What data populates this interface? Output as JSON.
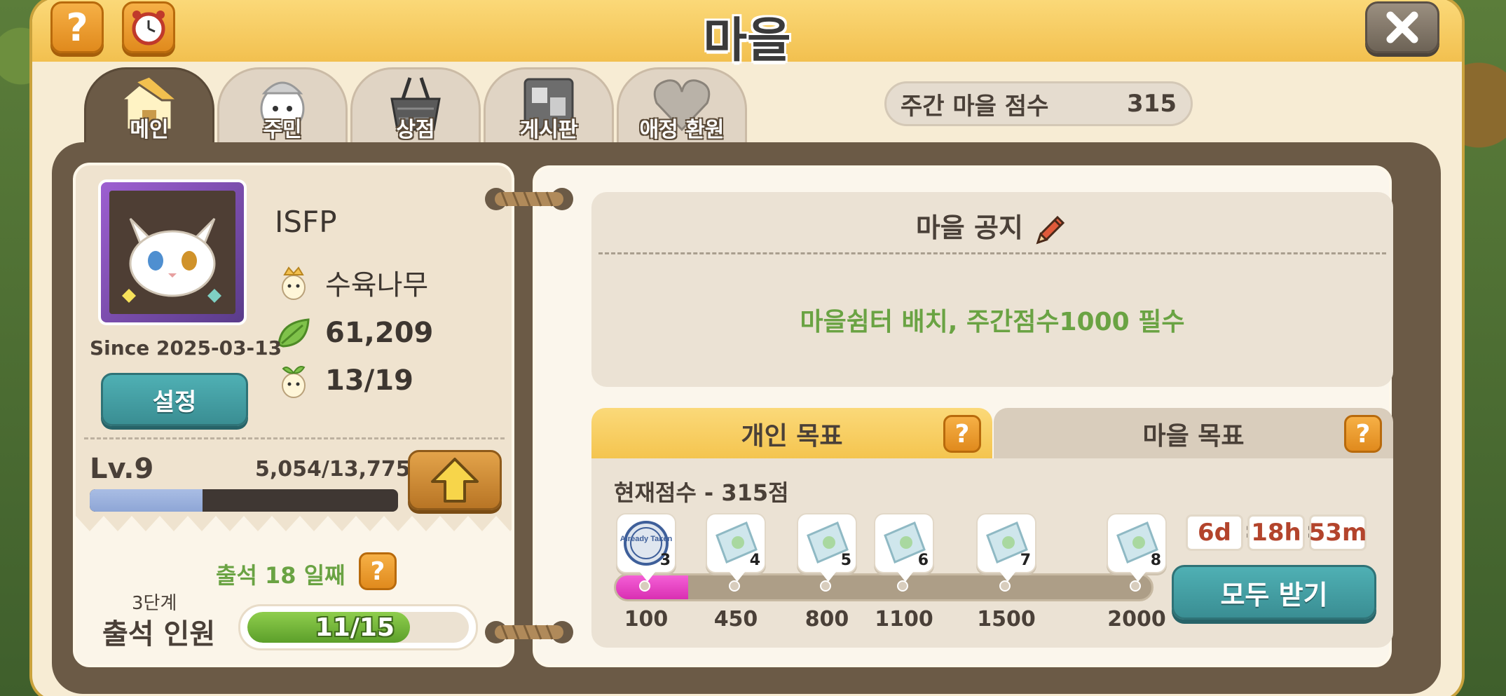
{
  "window": {
    "title": "마을"
  },
  "tabs": [
    {
      "label": "메인",
      "icon": "house-icon",
      "active": true
    },
    {
      "label": "주민",
      "icon": "resident-icon",
      "active": false
    },
    {
      "label": "상점",
      "icon": "shop-basket-icon",
      "active": false
    },
    {
      "label": "게시판",
      "icon": "board-icon",
      "active": false
    },
    {
      "label": "애정 환원",
      "icon": "heart-icon",
      "active": false
    }
  ],
  "weekly_score": {
    "label": "주간 마을 점수",
    "value": "315"
  },
  "profile": {
    "nickname": "ISFP",
    "since": "Since 2025-03-13",
    "leader_name": "수육나무",
    "leaves": "61,209",
    "members": "13/19",
    "settings_label": "설정",
    "level": "Lv.9",
    "exp_text": "5,054/13,775",
    "exp_progress": 0.367
  },
  "attendance": {
    "days_label": "출석 18 일째",
    "stage_label": "3단계",
    "count_label": "출석 인원",
    "progress_text": "11/15",
    "progress": 0.733
  },
  "notice": {
    "title": "마을 공지",
    "text": "마을쉼터 배치, 주간점수1000 필수"
  },
  "goals": {
    "personal_tab": "개인 목표",
    "village_tab": "마을 목표",
    "current_score": "현재점수 - 315점",
    "milestones": [
      {
        "num": "3",
        "value": "100",
        "taken": true,
        "taken_label": "Already Taken"
      },
      {
        "num": "4",
        "value": "450",
        "taken": false
      },
      {
        "num": "5",
        "value": "800",
        "taken": false
      },
      {
        "num": "6",
        "value": "1100",
        "taken": false
      },
      {
        "num": "7",
        "value": "1500",
        "taken": false
      },
      {
        "num": "8",
        "value": "2000",
        "taken": false
      }
    ],
    "progress_fraction": 0.135,
    "timer": {
      "days": "6d",
      "hours": "18h",
      "minutes": "53m"
    },
    "claim_all_label": "모두 받기"
  },
  "colors": {
    "accent_yellow": "#f4c44e",
    "teal_button": "#3a8e93",
    "green_text": "#6aa343",
    "progress_pink": "#e03ab9"
  }
}
